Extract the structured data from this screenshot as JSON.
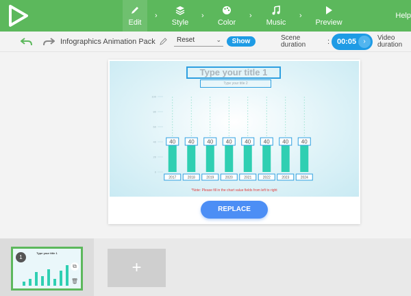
{
  "topbar": {
    "steps": [
      {
        "label": "Edit",
        "icon": "pencil-icon"
      },
      {
        "label": "Style",
        "icon": "layers-icon"
      },
      {
        "label": "Color",
        "icon": "palette-icon"
      },
      {
        "label": "Music",
        "icon": "music-note-icon"
      },
      {
        "label": "Preview",
        "icon": "play-icon"
      }
    ],
    "help": "Help",
    "colors": {
      "bar": "#5cb85c",
      "active": "#6fc06f"
    }
  },
  "toolbar": {
    "project_title": "Infographics Animation Pack",
    "reset_value": "Reset",
    "show_label": "Show",
    "scene_label_1": "Scene",
    "scene_label_2": "duration",
    "duration": "00:05",
    "video_label_1": "Video",
    "video_label_2": "duration"
  },
  "scene": {
    "title": "Type your title 1",
    "subtitle": "Type your title 2",
    "note": "*Note: Please fill in the chart value fields from left to right",
    "replace_label": "REPLACE"
  },
  "chart_data": {
    "type": "bar",
    "categories": [
      "2017",
      "2018",
      "2019",
      "2020",
      "2021",
      "2022",
      "2023",
      "2024"
    ],
    "values": [
      40,
      40,
      40,
      40,
      40,
      40,
      40,
      40
    ],
    "ylim": [
      0,
      100
    ],
    "yticks": [
      "100",
      "80",
      "60",
      "40",
      "20",
      "0"
    ],
    "bar_color": "#2fcfb2",
    "label_border": "#2d9fe0"
  },
  "strip": {
    "thumb_number": "1",
    "thumb_title": "Type your title 1",
    "add_label": "+"
  }
}
